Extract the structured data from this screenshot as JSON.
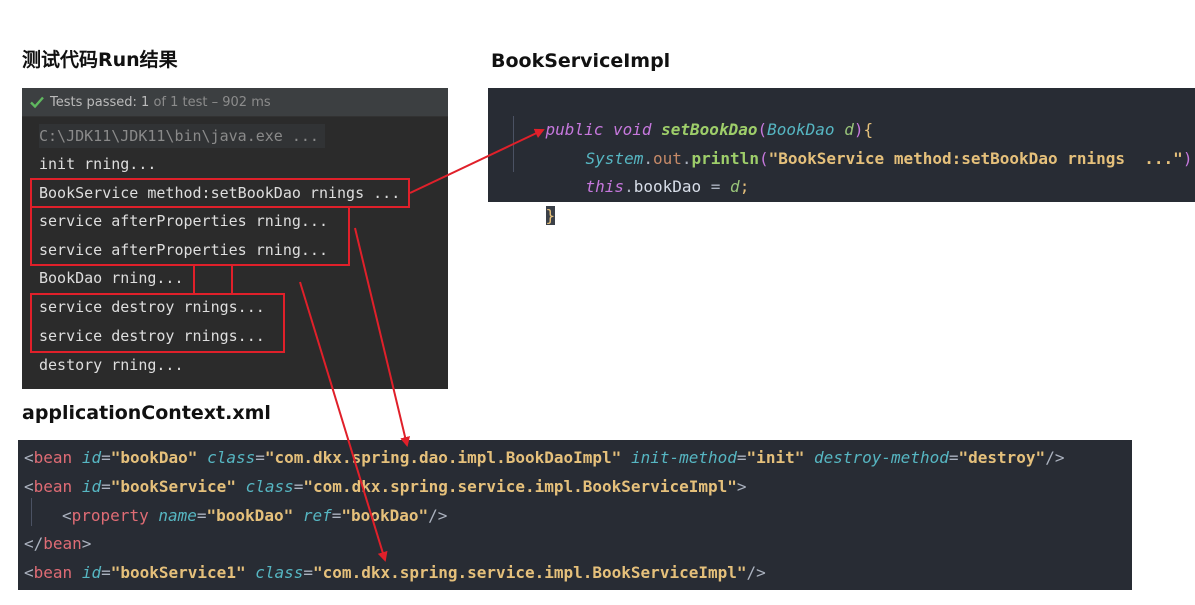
{
  "headings": {
    "run": "测试代码Run结果",
    "impl": "BookServiceImpl",
    "xml": "applicationContext.xml"
  },
  "run": {
    "status_text": "Tests passed:",
    "passed": "1",
    "of_text": "of 1 test – 902 ms",
    "icon": "check-icon",
    "lines": [
      "C:\\JDK11\\JDK11\\bin\\java.exe ...",
      "init rning...",
      "BookService method:setBookDao rnings ...",
      "service afterProperties rning...",
      "service afterProperties rning...",
      "BookDao rning...",
      "service destroy rnings...",
      "service destroy rnings...",
      "destory rning..."
    ]
  },
  "java": {
    "l1": {
      "kw_public": "public",
      "kw_void": "void",
      "method": "setBookDao",
      "open_paren": "(",
      "param_type": "BookDao",
      "param_name": "d",
      "close_paren": ")",
      "open_brace": "{"
    },
    "l2": {
      "cls": "System",
      "dot1": ".",
      "field": "out",
      "dot2": ".",
      "method": "println",
      "open_paren": "(",
      "str": "\"BookService method:setBookDao rnings  ...\"",
      "close_paren": ")",
      "semi": ";"
    },
    "l3": {
      "kw_this": "this",
      "dot": ".",
      "field": "bookDao",
      "eq": " = ",
      "param": "d",
      "semi": ";"
    },
    "l4": {
      "close_brace": "}"
    }
  },
  "xml": {
    "lines": [
      {
        "tag": "bean",
        "attrs": [
          {
            "name": "id",
            "value": "\"bookDao\""
          },
          {
            "name": "class",
            "value": "\"com.dkx.spring.dao.impl.BookDaoImpl\""
          },
          {
            "name": "init-method",
            "value": "\"init\""
          },
          {
            "name": "destroy-method",
            "value": "\"destroy\""
          }
        ],
        "end": "/>"
      },
      {
        "tag": "bean",
        "attrs": [
          {
            "name": "id",
            "value": "\"bookService\""
          },
          {
            "name": "class",
            "value": "\"com.dkx.spring.service.impl.BookServiceImpl\""
          }
        ],
        "end": ">"
      },
      {
        "tag": "property",
        "attrs": [
          {
            "name": "name",
            "value": "\"bookDao\""
          },
          {
            "name": "ref",
            "value": "\"bookDao\""
          }
        ],
        "end": "/>"
      },
      {
        "closing_tag": "bean"
      },
      {
        "tag": "bean",
        "attrs": [
          {
            "name": "id",
            "value": "\"bookService1\""
          },
          {
            "name": "class",
            "value": "\"com.dkx.spring.service.impl.BookServiceImpl\""
          }
        ],
        "end": "/>"
      }
    ]
  },
  "colors": {
    "annotation": "#e0202a",
    "console_bg": "#2b2b2b",
    "editor_bg": "#282c34",
    "pass_green": "#5fb85f"
  }
}
